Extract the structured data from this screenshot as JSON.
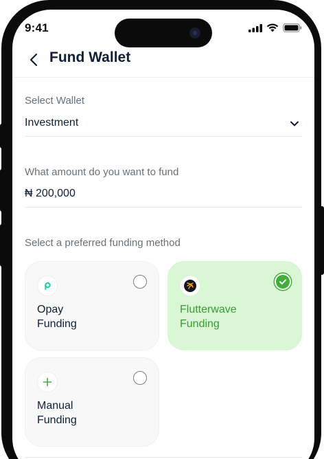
{
  "status_bar": {
    "time": "9:41"
  },
  "header": {
    "title": "Fund Wallet"
  },
  "wallet": {
    "label": "Select Wallet",
    "value": "Investment"
  },
  "amount": {
    "label": "What amount do you want to fund",
    "currency": "₦",
    "value": "200,000"
  },
  "method": {
    "label": "Select a preferred funding method",
    "options": [
      {
        "line1": "Opay",
        "line2": "Funding",
        "selected": false,
        "icon": "opay-logo-icon"
      },
      {
        "line1": "Flutterwave",
        "line2": "Funding",
        "selected": true,
        "icon": "flutterwave-logo-icon"
      },
      {
        "line1": "Manual",
        "line2": "Funding",
        "selected": false,
        "icon": "plus-icon"
      }
    ]
  },
  "colors": {
    "accent_green": "#3fae3a",
    "selected_bg": "#d9f7d4",
    "title": "#0f1f3a"
  }
}
